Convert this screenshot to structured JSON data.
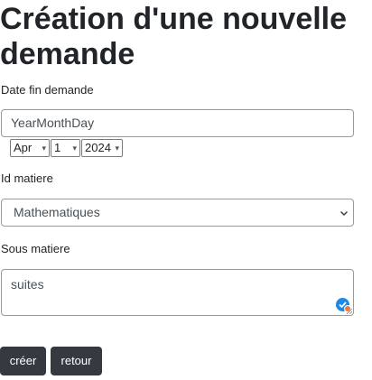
{
  "page": {
    "title": "Création d'une nouvelle demande"
  },
  "form": {
    "date_label": "Date fin demande",
    "date_placeholder": "YearMonthDay",
    "date_parts": {
      "month": "Apr",
      "day": "1",
      "year": "2024"
    },
    "matiere_label": "Id matiere",
    "matiere_value": "Mathematiques",
    "sous_matiere_label": "Sous matiere",
    "sous_matiere_value": "suites"
  },
  "actions": {
    "create_label": "créer",
    "back_label": "retour"
  },
  "colors": {
    "button_bg": "#343a40",
    "badge_blue": "#1e88e5",
    "badge_orange": "#f2793a"
  }
}
